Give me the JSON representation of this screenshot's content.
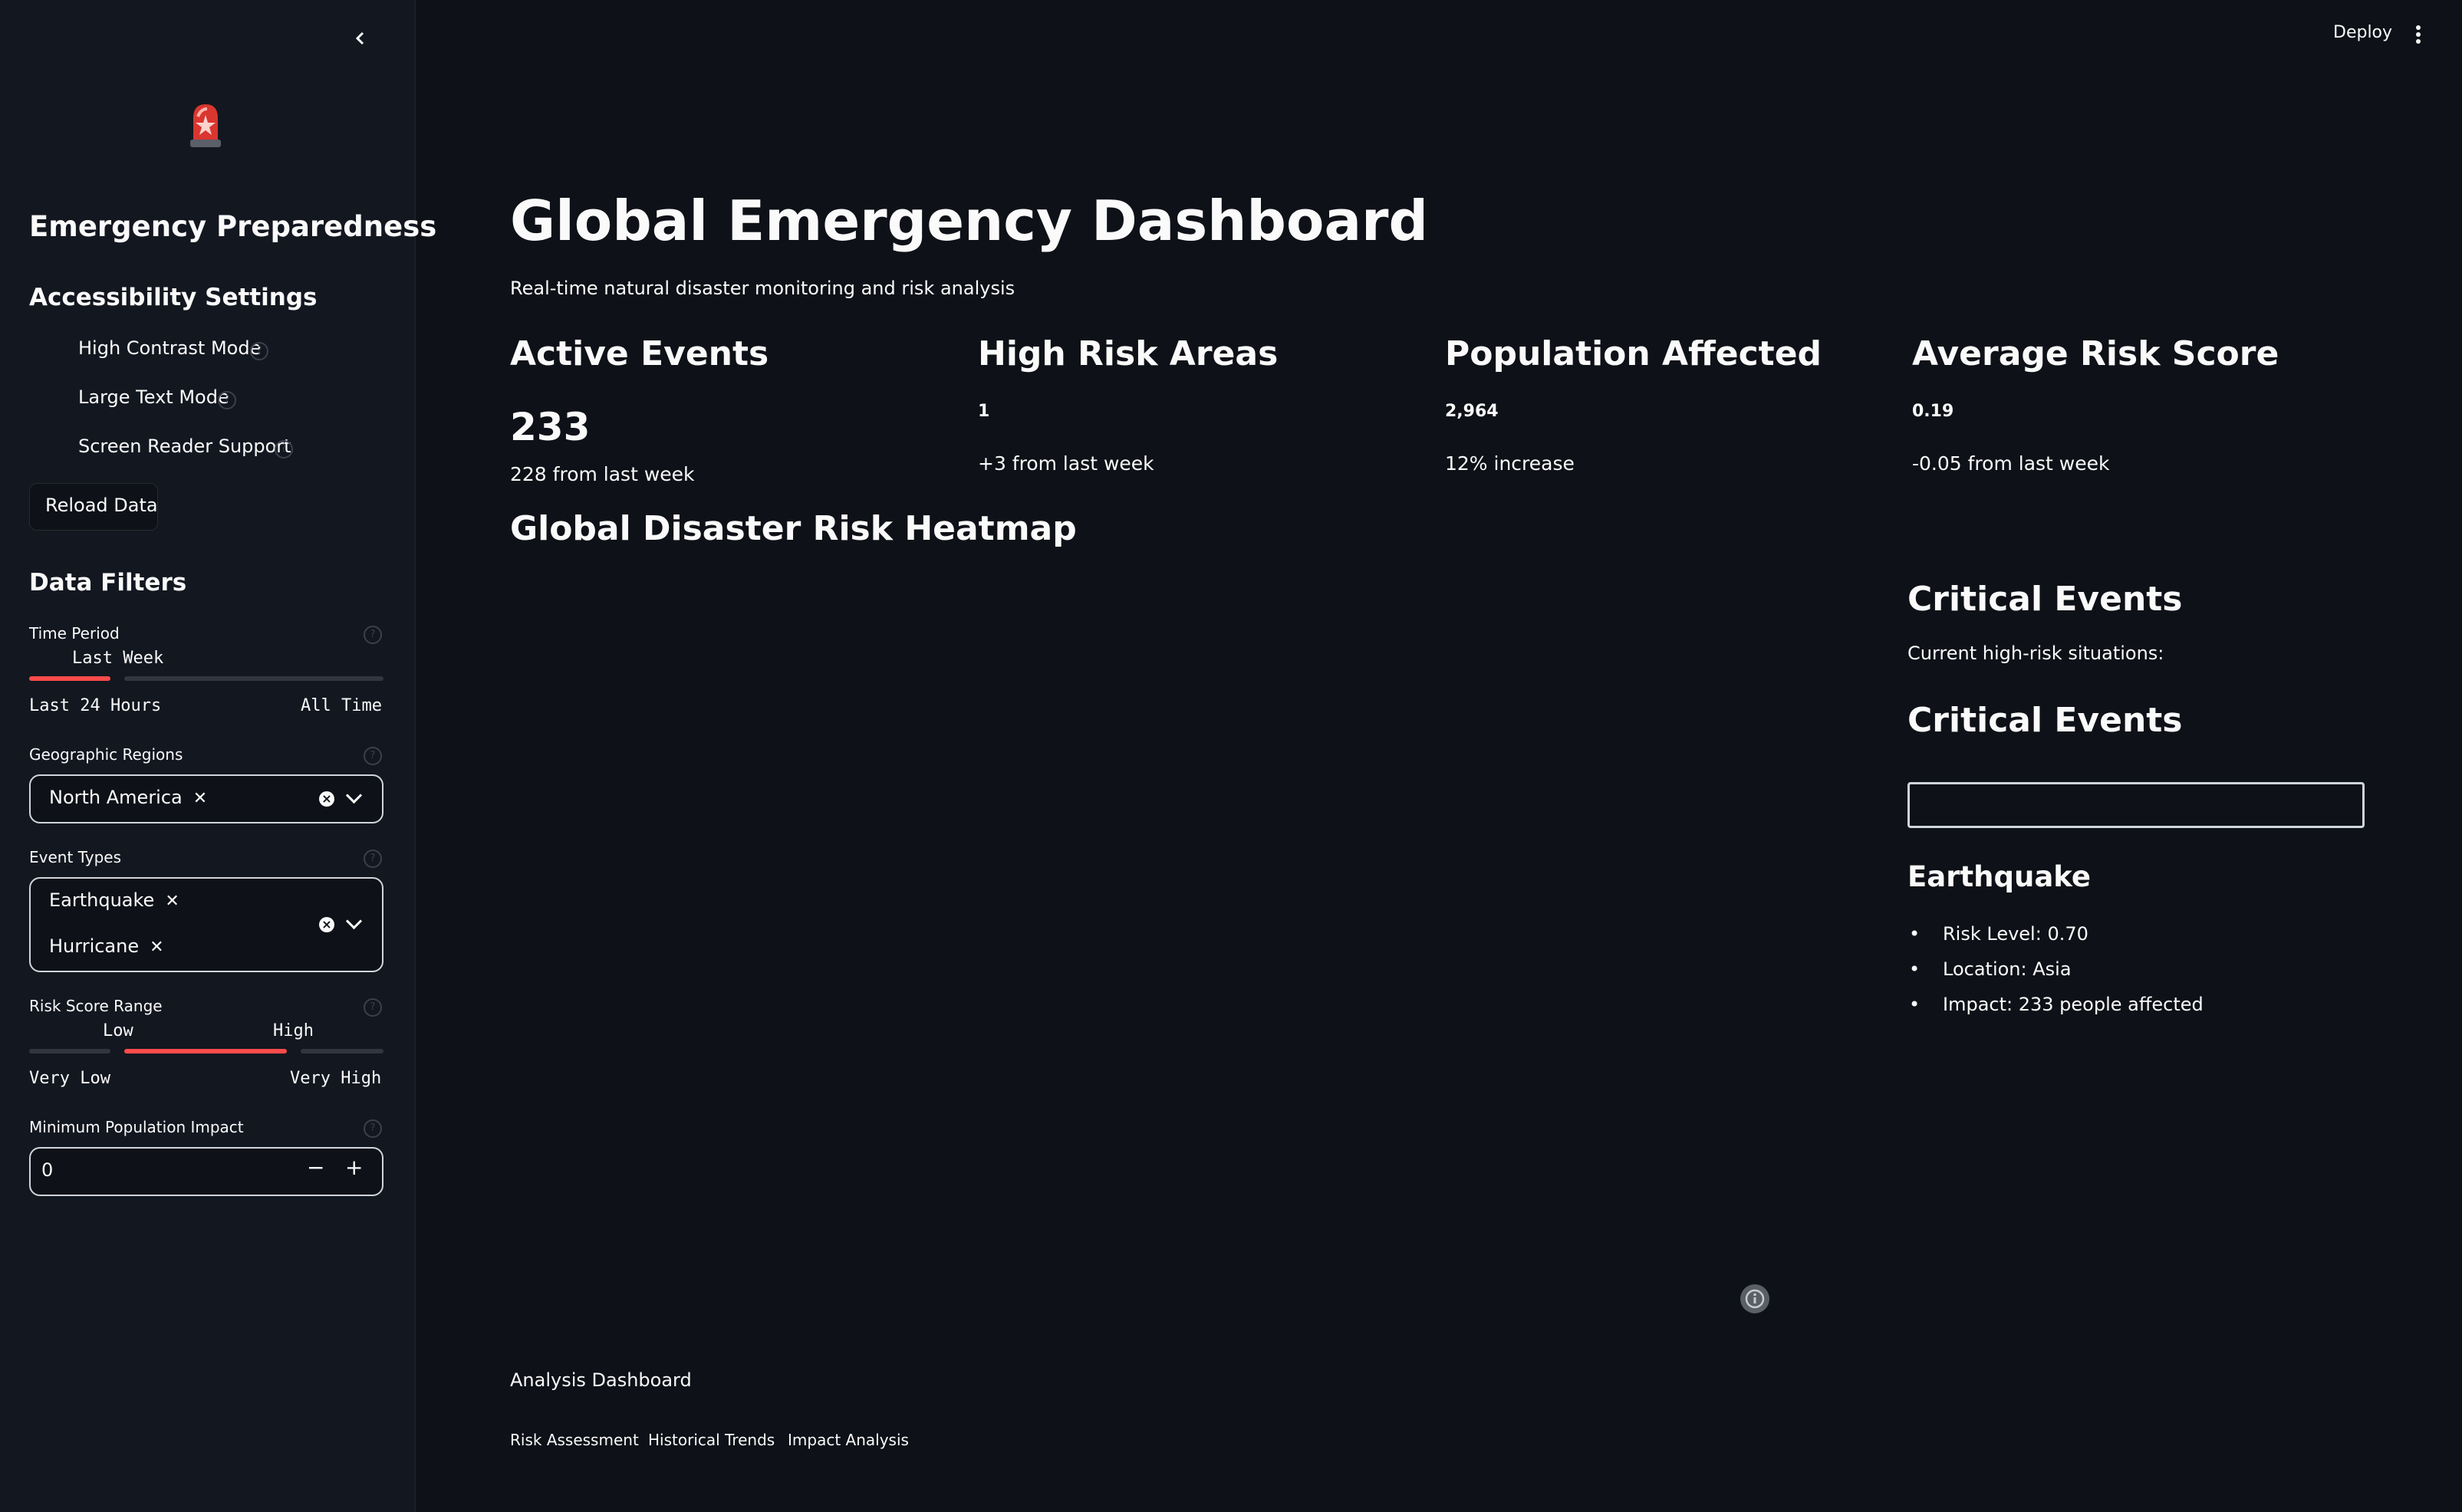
{
  "header": {
    "deploy_label": "Deploy",
    "menu_icon": "more-vert-icon",
    "collapse_icon": "chevron-left-icon"
  },
  "sidebar": {
    "logo_icon": "rotating-light-icon",
    "title": "Emergency Preparedness",
    "accessibility": {
      "heading": "Accessibility Settings",
      "toggles": [
        {
          "label": "High Contrast Mode",
          "checked": false
        },
        {
          "label": "Large Text Mode",
          "checked": false
        },
        {
          "label": "Screen Reader Support",
          "checked": false
        }
      ],
      "reload_label": "Reload Data"
    },
    "filters": {
      "heading": "Data Filters",
      "time_period": {
        "label": "Time Period",
        "value": "Last Week",
        "min": "Last 24 Hours",
        "max": "All Time"
      },
      "regions": {
        "label": "Geographic Regions",
        "selected": [
          "North America"
        ]
      },
      "event_types": {
        "label": "Event Types",
        "selected": [
          "Earthquake",
          "Hurricane"
        ]
      },
      "risk_range": {
        "label": "Risk Score Range",
        "low_value": "Low",
        "high_value": "High",
        "min": "Very Low",
        "max": "Very High"
      },
      "min_population": {
        "label": "Minimum Population Impact",
        "value": "0"
      }
    }
  },
  "main": {
    "title": "Global Emergency Dashboard",
    "subtitle": "Real-time natural disaster monitoring and risk analysis",
    "metrics": [
      {
        "label": "Active Events",
        "value": "233",
        "delta": "228 from last week"
      },
      {
        "label": "High Risk Areas",
        "value": "1",
        "delta": "+3 from last week"
      },
      {
        "label": "Population Affected",
        "value": "2,964",
        "delta": "12% increase"
      },
      {
        "label": "Average Risk Score",
        "value": "0.19",
        "delta": "-0.05 from last week"
      }
    ],
    "heatmap_title": "Global Disaster Risk Heatmap",
    "critical": {
      "heading": "Critical Events",
      "subtext": "Current high-risk situations:",
      "heading2": "Critical Events",
      "event_title": "Earthquake",
      "details": [
        "Risk Level: 0.70",
        "Location: Asia",
        "Impact: 233 people affected"
      ]
    },
    "analysis": {
      "title": "Analysis Dashboard",
      "tabs": [
        "Risk Assessment",
        "Historical Trends",
        "Impact Analysis"
      ]
    }
  }
}
